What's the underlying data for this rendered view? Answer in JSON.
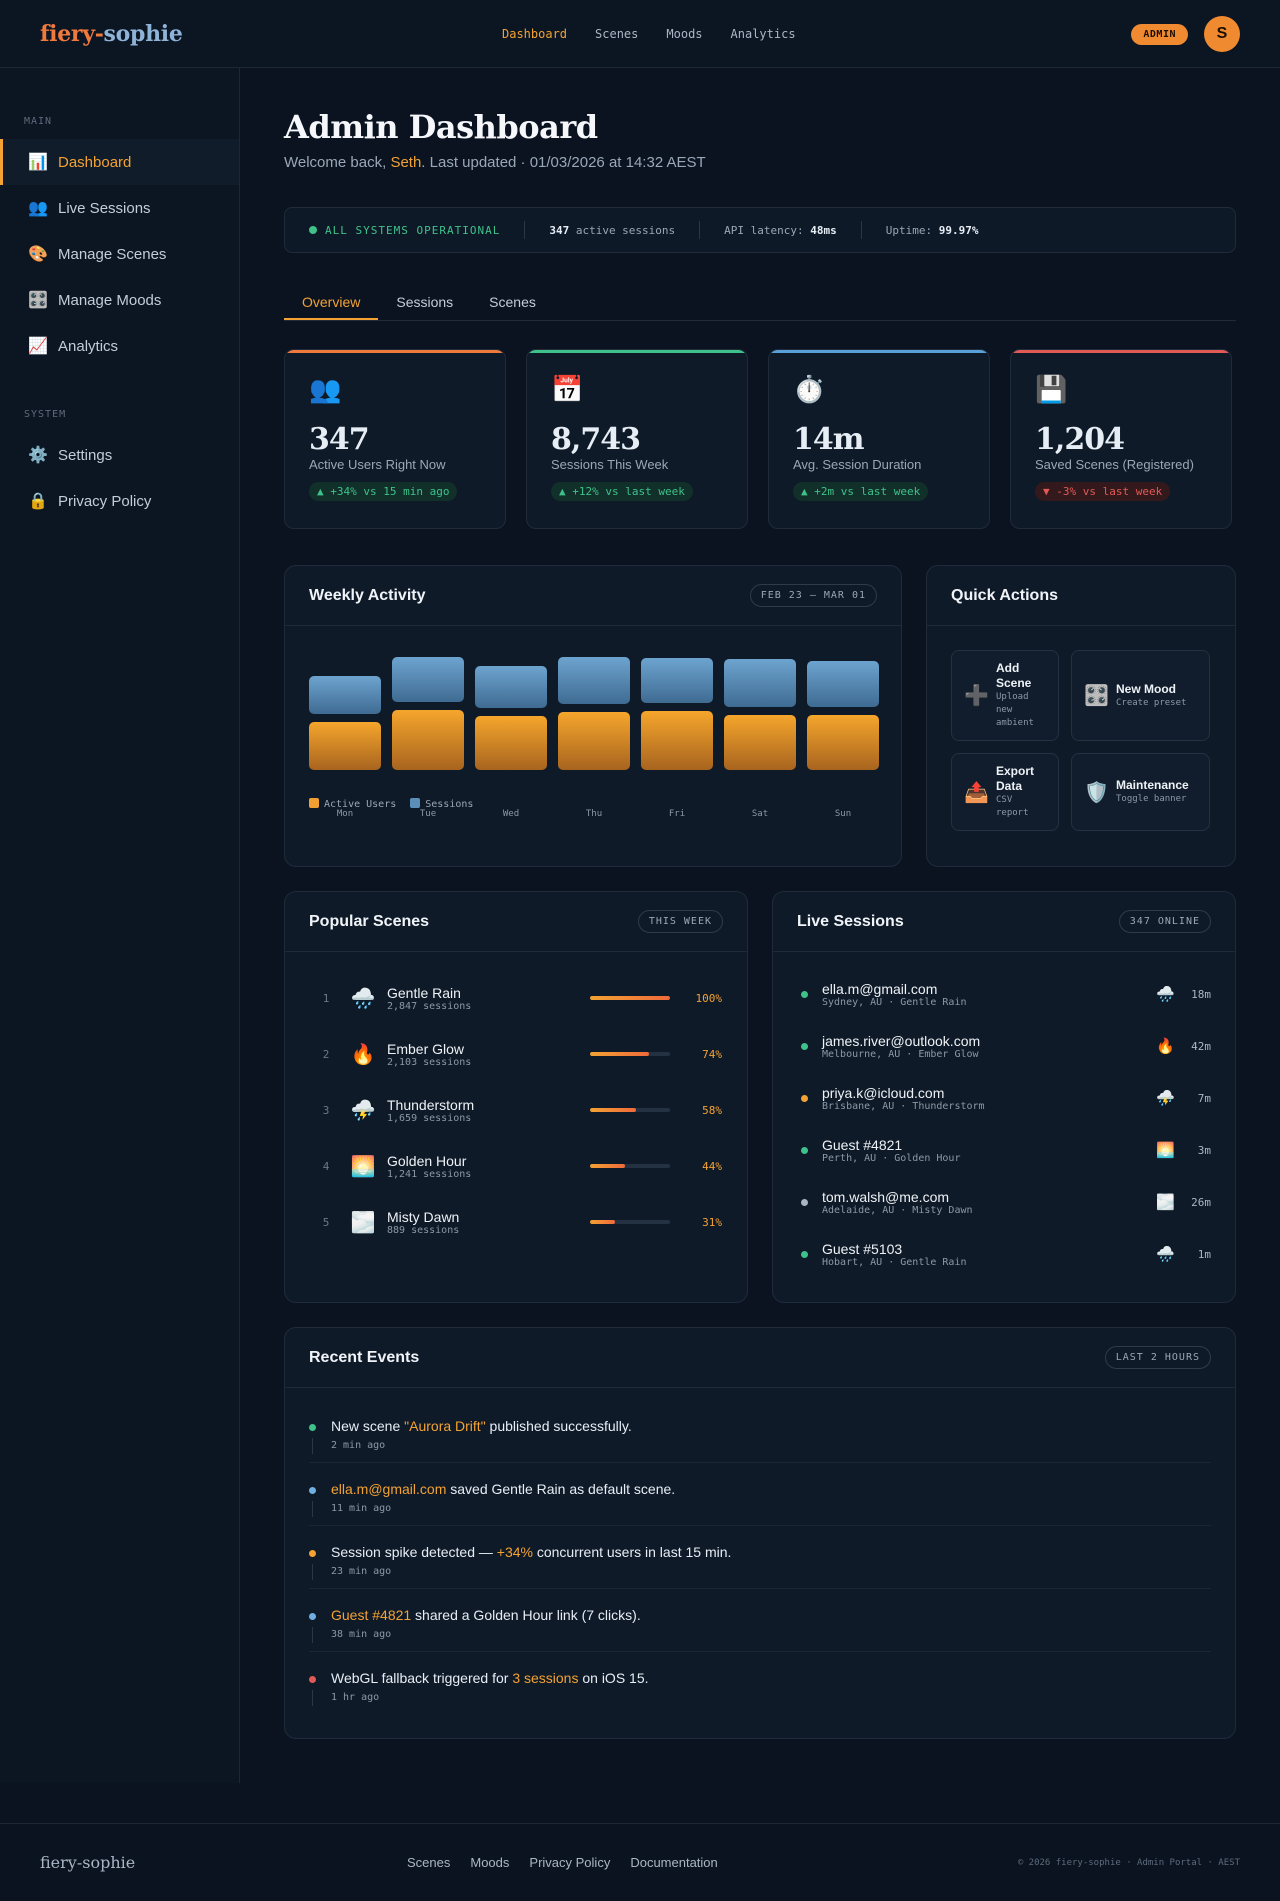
{
  "brand": {
    "part1": "fiery",
    "dash": "-",
    "part2": "sophie"
  },
  "topnav": [
    {
      "label": "Dashboard",
      "active": true
    },
    {
      "label": "Scenes"
    },
    {
      "label": "Moods"
    },
    {
      "label": "Analytics"
    }
  ],
  "admin_badge": "ADMIN",
  "avatar_initial": "S",
  "sidebar": {
    "main_label": "MAIN",
    "system_label": "SYSTEM",
    "main_items": [
      {
        "label": "Dashboard",
        "icon": "📊",
        "icon_name": "bar-chart-icon",
        "active": true
      },
      {
        "label": "Live Sessions",
        "icon": "👥",
        "icon_name": "users-icon"
      },
      {
        "label": "Manage Scenes",
        "icon": "🎨",
        "icon_name": "palette-icon"
      },
      {
        "label": "Manage Moods",
        "icon": "🎛️",
        "icon_name": "control-knobs-icon"
      },
      {
        "label": "Analytics",
        "icon": "📈",
        "icon_name": "trend-chart-icon"
      }
    ],
    "system_items": [
      {
        "label": "Settings",
        "icon": "⚙️",
        "icon_name": "gear-icon"
      },
      {
        "label": "Privacy Policy",
        "icon": "🔒",
        "icon_name": "lock-icon"
      }
    ]
  },
  "header": {
    "title": "Admin Dashboard",
    "welcome_prefix": "Welcome back, ",
    "user": "Seth",
    "updated": ". Last updated · 01/03/2026 at 14:32 AEST"
  },
  "status": {
    "ok": "ALL SYSTEMS OPERATIONAL",
    "sessions_value": "347",
    "sessions_label": " active sessions",
    "latency_label": "API latency: ",
    "latency_value": "48ms",
    "uptime_label": "Uptime: ",
    "uptime_value": "99.97%"
  },
  "tabs": [
    {
      "label": "Overview",
      "active": true
    },
    {
      "label": "Sessions"
    },
    {
      "label": "Scenes"
    }
  ],
  "stats": [
    {
      "icon": "👥",
      "icon_name": "users-icon",
      "value": "347",
      "label": "Active Users Right Now",
      "delta": "▲ +34% vs 15 min ago",
      "dir": "up",
      "color": "#f07a3e"
    },
    {
      "icon": "📅",
      "icon_name": "calendar-icon",
      "value": "8,743",
      "label": "Sessions This Week",
      "delta": "▲ +12% vs last week",
      "dir": "up",
      "color": "#3ec28a"
    },
    {
      "icon": "⏱️",
      "icon_name": "stopwatch-icon",
      "value": "14m",
      "label": "Avg. Session Duration",
      "delta": "▲ +2m vs last week",
      "dir": "up",
      "color": "#5aa0d8"
    },
    {
      "icon": "💾",
      "icon_name": "floppy-disk-icon",
      "value": "1,204",
      "label": "Saved Scenes (Registered)",
      "delta": "▼ -3% vs last week",
      "dir": "down",
      "color": "#e25a55"
    }
  ],
  "weekly": {
    "title": "Weekly Activity",
    "range": "FEB 23 – MAR 01",
    "legend_users": "Active Users",
    "legend_sessions": "Sessions"
  },
  "chart_data": {
    "type": "bar",
    "categories": [
      "Mon",
      "Tue",
      "Wed",
      "Thu",
      "Fri",
      "Sat",
      "Sun"
    ],
    "series": [
      {
        "name": "Active Users",
        "color": "#f0a033",
        "values": [
          48,
          60,
          54,
          58,
          59,
          55,
          55
        ]
      },
      {
        "name": "Sessions",
        "color": "#5b8fba",
        "values": [
          38,
          45,
          42,
          47,
          45,
          48,
          46
        ]
      }
    ]
  },
  "quick": {
    "title": "Quick Actions",
    "actions": [
      {
        "icon": "➕",
        "icon_name": "plus-icon",
        "title": "Add Scene",
        "sub": "Upload new ambient"
      },
      {
        "icon": "🎛️",
        "icon_name": "control-knobs-icon",
        "title": "New Mood",
        "sub": "Create preset"
      },
      {
        "icon": "📤",
        "icon_name": "export-tray-icon",
        "title": "Export Data",
        "sub": "CSV report"
      },
      {
        "icon": "🛡️",
        "icon_name": "shield-icon",
        "title": "Maintenance",
        "sub": "Toggle banner"
      }
    ]
  },
  "popular": {
    "title": "Popular Scenes",
    "pill": "THIS WEEK",
    "items": [
      {
        "rank": "1",
        "icon": "🌧️",
        "icon_name": "rain-cloud-icon",
        "name": "Gentle Rain",
        "sessions": "2,847 sessions",
        "pct": "100%",
        "pct_value": 100
      },
      {
        "rank": "2",
        "icon": "🔥",
        "icon_name": "fire-icon",
        "name": "Ember Glow",
        "sessions": "2,103 sessions",
        "pct": "74%",
        "pct_value": 74
      },
      {
        "rank": "3",
        "icon": "⛈️",
        "icon_name": "thunderstorm-icon",
        "name": "Thunderstorm",
        "sessions": "1,659 sessions",
        "pct": "58%",
        "pct_value": 58
      },
      {
        "rank": "4",
        "icon": "🌅",
        "icon_name": "sunrise-icon",
        "name": "Golden Hour",
        "sessions": "1,241 sessions",
        "pct": "44%",
        "pct_value": 44
      },
      {
        "rank": "5",
        "icon": "🌫️",
        "icon_name": "fog-icon",
        "name": "Misty Dawn",
        "sessions": "889 sessions",
        "pct": "31%",
        "pct_value": 31
      }
    ]
  },
  "live": {
    "title": "Live Sessions",
    "pill": "347 ONLINE",
    "items": [
      {
        "name": "ella.m@gmail.com",
        "meta": "Sydney, AU · Gentle Rain",
        "icon": "🌧️",
        "icon_name": "rain-cloud-icon",
        "time": "18m",
        "dot": "#3ec28a"
      },
      {
        "name": "james.river@outlook.com",
        "meta": "Melbourne, AU · Ember Glow",
        "icon": "🔥",
        "icon_name": "fire-icon",
        "time": "42m",
        "dot": "#3ec28a"
      },
      {
        "name": "priya.k@icloud.com",
        "meta": "Brisbane, AU · Thunderstorm",
        "icon": "⛈️",
        "icon_name": "thunderstorm-icon",
        "time": "7m",
        "dot": "#f3a233"
      },
      {
        "name": "Guest #4821",
        "meta": "Perth, AU · Golden Hour",
        "icon": "🌅",
        "icon_name": "sunrise-icon",
        "time": "3m",
        "dot": "#3ec28a"
      },
      {
        "name": "tom.walsh@me.com",
        "meta": "Adelaide, AU · Misty Dawn",
        "icon": "🌫️",
        "icon_name": "fog-icon",
        "time": "26m",
        "dot": "#aab6c5"
      },
      {
        "name": "Guest #5103",
        "meta": "Hobart, AU · Gentle Rain",
        "icon": "🌧️",
        "icon_name": "rain-cloud-icon",
        "time": "1m",
        "dot": "#3ec28a"
      }
    ]
  },
  "events": {
    "title": "Recent Events",
    "pill": "LAST 2 HOURS",
    "items": [
      {
        "dot": "#3ec28a",
        "pre": "New scene ",
        "hl": "\"Aurora Drift\"",
        "post": " published successfully.",
        "time": "2 min ago"
      },
      {
        "dot": "#6fb0e0",
        "pre": "",
        "hl": "ella.m@gmail.com",
        "post": " saved Gentle Rain as default scene.",
        "time": "11 min ago"
      },
      {
        "dot": "#f3a233",
        "pre": "Session spike detected — ",
        "hl": "+34%",
        "post": " concurrent users in last 15 min.",
        "time": "23 min ago"
      },
      {
        "dot": "#6fb0e0",
        "pre": "",
        "hl": "Guest #4821",
        "post": " shared a Golden Hour link (7 clicks).",
        "time": "38 min ago"
      },
      {
        "dot": "#e25a55",
        "pre": "WebGL fallback triggered for ",
        "hl": "3 sessions",
        "post": " on iOS 15.",
        "time": "1 hr ago"
      }
    ]
  },
  "footer": {
    "logo": "fiery-sophie",
    "links": [
      "Scenes",
      "Moods",
      "Privacy Policy",
      "Documentation"
    ],
    "copyright": "© 2026 fiery-sophie · Admin Portal · AEST"
  }
}
